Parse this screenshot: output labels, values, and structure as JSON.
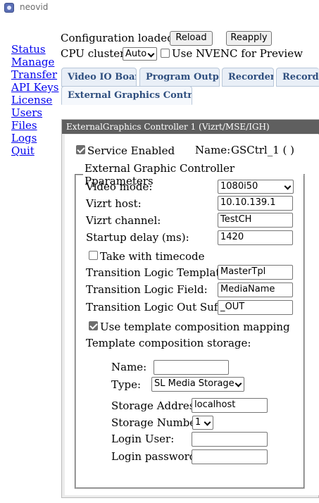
{
  "window": {
    "title": "neovid"
  },
  "nav": [
    "Status",
    "Manage",
    "Transfer",
    "API Keys",
    "License",
    "Users",
    "Files",
    "Logs",
    "Quit"
  ],
  "header": {
    "config_status": "Configuration loaded",
    "reload_label": "Reload",
    "reapply_label": "Reapply",
    "cpu_clusters_label": "CPU clusters:",
    "cpu_clusters_value": "Auto",
    "nvenc_label": "Use NVENC for Preview",
    "nvenc_checked": false
  },
  "tabs": {
    "row1": [
      "Video IO Boards",
      "Program Outputs",
      "Recorders",
      "Recordings"
    ],
    "row2": [
      "External Graphics Controllers"
    ],
    "active": "External Graphics Controllers"
  },
  "controller": {
    "header": "ExternalGraphics Controller 1 (Vizrt/MSE/IGH)",
    "service_enabled_label": "Service Enabled",
    "service_enabled": true,
    "name_label": "Name:",
    "name_value": "GSCtrl_1 ( )",
    "params_legend": "External Graphic Controller Pparameters",
    "video_mode_label": "Video mode:",
    "video_mode_value": "1080i50",
    "vizrt_host_label": "Vizrt host:",
    "vizrt_host_value": "10.10.139.1",
    "vizrt_channel_label": "Vizrt channel:",
    "vizrt_channel_value": "TestCH",
    "startup_delay_label": "Startup delay (ms):",
    "startup_delay_value": "1420",
    "take_timecode_label": "Take with timecode",
    "take_timecode": false,
    "tl_template_label": "Transition Logic Template:",
    "tl_template_value": "MasterTpl",
    "tl_field_label": "Transition Logic Field:",
    "tl_field_value": "MediaName",
    "tl_suffix_label": "Transition Logic Out Suffix:",
    "tl_suffix_value": "_OUT",
    "use_mapping_label": "Use template composition mapping",
    "use_mapping": true,
    "storage_label": "Template composition storage:",
    "storage": {
      "name_label": "Name:",
      "name_value": "",
      "type_label": "Type:",
      "type_value": "SL Media Storage",
      "address_label": "Storage Address:",
      "address_value": "localhost",
      "number_label": "Storage Number:",
      "number_value": "1",
      "login_user_label": "Login User:",
      "login_user_value": "",
      "login_password_label": "Login password:",
      "login_password_value": ""
    }
  }
}
